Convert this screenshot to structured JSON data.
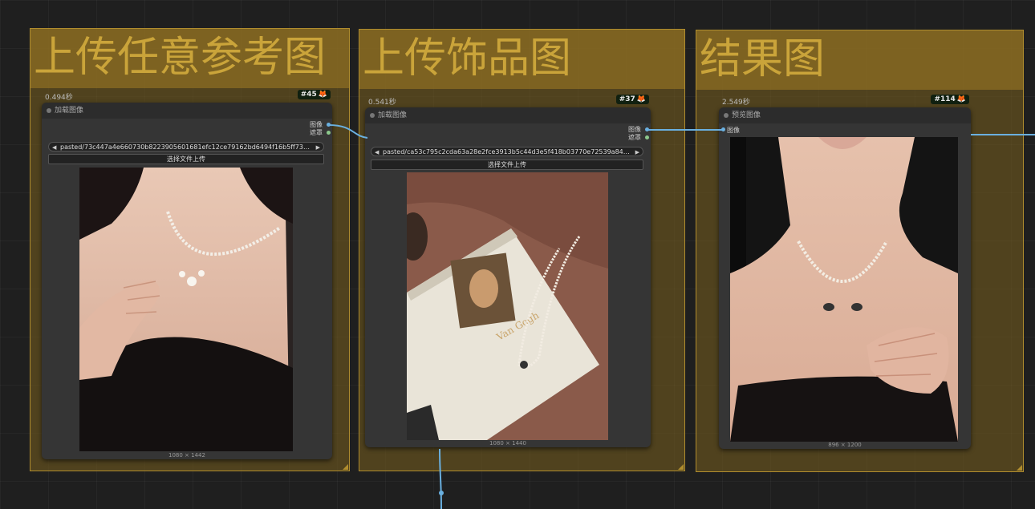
{
  "groups": [
    {
      "title": "上传任意参考图"
    },
    {
      "title": "上传饰品图"
    },
    {
      "title": "结果图"
    }
  ],
  "nodes": {
    "load1": {
      "time": "0.494秒",
      "id": "#45",
      "title": "加载图像",
      "outputs": [
        "图像",
        "遮罩"
      ],
      "filename": "pasted/73c447a4e660730b8223905601681efc12ce79162bd6494f16b5ff73e6bedd6d. ...",
      "upload_label": "选择文件上传",
      "dims": "1080 × 1442"
    },
    "load2": {
      "time": "0.541秒",
      "id": "#37",
      "title": "加载图像",
      "outputs": [
        "图像",
        "遮罩"
      ],
      "filename": "pasted/ca53c795c2cda63a28e2fce3913b5c44d3e5f418b03770e72539a84d5184578...",
      "upload_label": "选择文件上传",
      "dims": "1080 × 1440"
    },
    "preview": {
      "time": "2.549秒",
      "id": "#114",
      "title": "预览图像",
      "input": "图像",
      "dims": "896 × 1200"
    }
  },
  "colors": {
    "wire": "#6ab0e0",
    "group_bg": "#7a5f1e",
    "group_title": "#caa43a"
  }
}
